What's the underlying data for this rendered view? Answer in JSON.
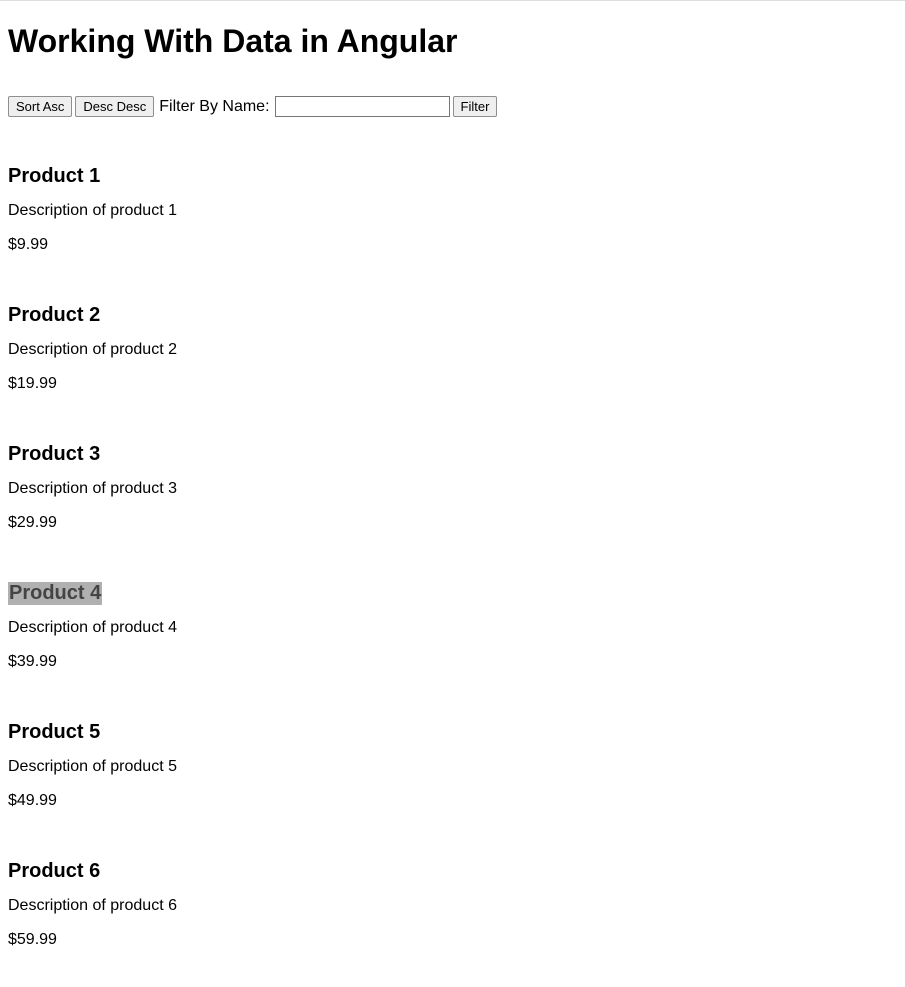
{
  "header": {
    "title": "Working With Data in Angular"
  },
  "controls": {
    "sort_asc_label": "Sort Asc",
    "sort_desc_label": "Desc Desc",
    "filter_label": "Filter By Name:",
    "filter_input_value": "",
    "filter_input_placeholder": "",
    "filter_button_label": "Filter"
  },
  "products": [
    {
      "name": "Product 1",
      "description": "Description of product 1",
      "price": "$9.99",
      "highlighted": false
    },
    {
      "name": "Product 2",
      "description": "Description of product 2",
      "price": "$19.99",
      "highlighted": false
    },
    {
      "name": "Product 3",
      "description": "Description of product 3",
      "price": "$29.99",
      "highlighted": false
    },
    {
      "name": "Product 4",
      "description": "Description of product 4",
      "price": "$39.99",
      "highlighted": true
    },
    {
      "name": "Product 5",
      "description": "Description of product 5",
      "price": "$49.99",
      "highlighted": false
    },
    {
      "name": "Product 6",
      "description": "Description of product 6",
      "price": "$59.99",
      "highlighted": false
    }
  ]
}
